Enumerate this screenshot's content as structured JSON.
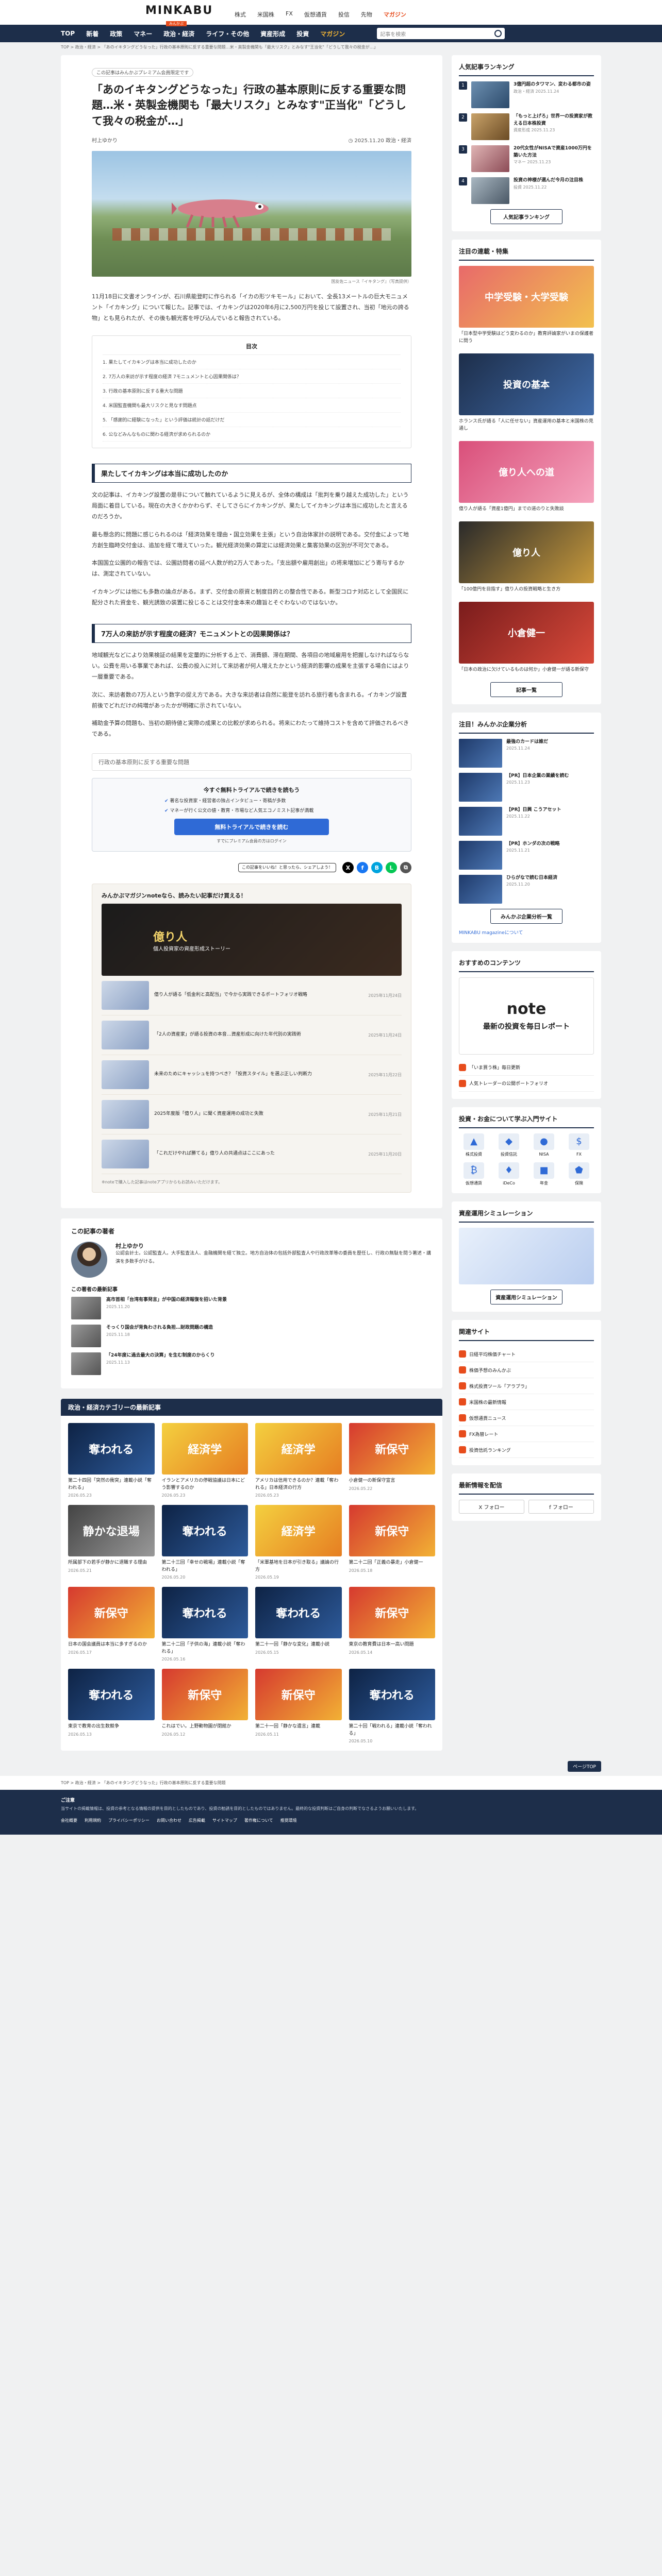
{
  "header": {
    "logo": "MINKABU",
    "logo_sub": "みんかぶ",
    "top_links": [
      "株式",
      "米国株",
      "FX",
      "仮想通貨",
      "投信",
      "先物",
      "マガジン"
    ],
    "nav": [
      "TOP",
      "新着",
      "政策",
      "マネー",
      "政治・経済",
      "ライフ・その他",
      "資産形成",
      "投資",
      "マガジン"
    ],
    "search_placeholder": "記事を検索"
  },
  "breadcrumb": "TOP > 政治・経済 > 「あのイキタングどうなった」行政の基本原則に反する重要な問題…米・英製金機関も「最大リスク」とみなす\"王当化\"「どうして我々の税金が…」",
  "article": {
    "badge": "この記事はみんかぶプレミアム会員限定です",
    "title": "「あのイキタングどうなった」行政の基本原則に反する重要な問題…米・英製金機関も「最大リスク」とみなす\"正当化\"「どうして我々の税金が…」",
    "author": "村上ゆかり",
    "date": "2025.11.20",
    "tags": "政治・経済",
    "caption": "国友佐ニュース『イキタング』（写真提供）",
    "lead": "11月18日に文書オンラインが、石川県能登町に作られる「イカの形ツキモール」において、全長13メートルの巨大モニュメント「イカキング」について報じた。記事では、イカキングは2020年6月に2,500万円を投じて設置され、当初「地元の誇る物」とも見られたが、その後も観光客を呼び込んでいると報告されている。",
    "toc_title": "目次",
    "toc": [
      "1. 果たしてイカキングは本当に成功したのか",
      "2. 7万人の来訪が示す程度の経済 7モニュメントと心因果関係は？",
      "3. 行政の基本原則に反する重大な問題",
      "4. 米国監査機関も最大リスクと見なす問題点",
      "5. 「感謝的に経験になった」という評価は統計の話だけだ",
      "6. 公などみんなものに関わる経済が求められるのか"
    ],
    "h1": "果たしてイカキングは本当に成功したのか",
    "p1": "文の記事は、イカキング設置の是非について触れているように見えるが、全体の構成は「批判を乗り越えた成功した」という局面に着目している。現在の大きくかかわらず、そしてさらにイカキングが、果たしてイカキングは本当に成功したと言えるのだろうか。",
    "p2": "最も懸念的に問題に感じられるのは「経済効果を理由・国立効果を主張」という自治体家計の説明である。交付金によって地方創生臨時交付金は、追加を経て増えていった。観光経済効果の算定には経済効果と集客効果の区別が不可欠である。",
    "p3": "本国国立公園的の報告では、公園訪問者の延べ人数が約2万人であった。「支出額や雇用創出」の将来増加にどう寄与するかは、測定されていない。",
    "p4": "イカキングには他にも多数の論点がある。まず、交付金の原資と制度目的との整合性である。新型コロナ対応として全国民に配分された資金を、観光誘致の装置に投じることは交付金本来の趣旨とそぐわないのではないか。",
    "h2": "7万人の来訪が示す程度の経済？モニュメントとの因果関係は？",
    "p5": "地域観光などにより効果検証の結果を定量的に分析する上で、消費額、滞在期間、各項目の地域雇用を把握しなければならない。公費を用いる事業であれば、公費の投入に対して来訪者が何人増えたかという経済的影響の成果を主張する場合にはより一層重要である。",
    "p6": "次に、来訪者数の7万人という数字の捉え方である。大きな来訪者は自然に能登を訪れる旅行者も含まれる。イカキング設置前後でどれだけの純増があったかが明確に示されていない。",
    "p7": "補助金予算の問題も、当初の期待値と実際の成果との比較が求められる。将来にわたって維持コストを含めて評価されるべきである。",
    "reco": "行政の基本原則に反する重要な問題",
    "cta_title": "今すぐ無料トライアルで続きを読もう",
    "cta_lines": [
      "著名な投資家・経営者の独占インタビュー・寄稿が多数",
      "マネーが行く公文の値・教育・市場など人気エコノミスト記事が満載"
    ],
    "cta_button": "無料トライアルで続きを読む",
    "cta_sub": "すでにプレミアム会員の方はログイン",
    "share_bubble": "この記事をいいね！と思ったら、シェアしよう！"
  },
  "note_box": {
    "title": "みんかぶマガジンnoteなら、読みたい記事だけ買える！",
    "banner_title": "億り人",
    "banner_sub": "個人投資家の資産形成ストーリー",
    "items": [
      {
        "text": "億り人が語る「低金利と高配当」で今から実践できるポートフォリオ戦略",
        "time": "2025年11月24日"
      },
      {
        "text": "「2人の資産家」が語る投資の本音…資産形成に向けた年代別の実践術",
        "time": "2025年11月24日"
      },
      {
        "text": "未来のためにキャッシュを持つべき？「投資スタイル」を選ぶ正しい判断力",
        "time": "2025年11月22日"
      },
      {
        "text": "2025年度版「億り人」に聞く資産運用の成功と失敗",
        "time": "2025年11月21日"
      },
      {
        "text": "「これだけやれば勝てる」億り人の共通点はここにあった",
        "time": "2025年11月20日"
      }
    ],
    "footnote": "※noteで購入した記事はnoteアプリからもお読みいただけます。"
  },
  "author_box": {
    "heading": "この記事の著者",
    "name": "村上ゆかり",
    "bio": "公認会計士。公認監査人。大手監査法人、金融機関を経て独立。地方自治体の包括外部監査人や行政改革等の委員を歴任し、行政の無駄を問う著述・講演を多数手がける。",
    "related_heading": "この著者の最新記事",
    "related": [
      {
        "title": "高市首相「台湾有事発言」が中国の経済報復を招いた背景",
        "date": "2025.11.20"
      },
      {
        "title": "そっくり国会が背負わされる負担…財政問題の構造",
        "date": "2025.11.18"
      },
      {
        "title": "「24年度に過去最大の決算」を生む制度のからくり",
        "date": "2025.11.13"
      }
    ]
  },
  "category": {
    "heading": "政治・経済カテゴリーの最新記事",
    "items": [
      {
        "img": "奪われる",
        "title": "第二十四回「突然の衝突」連載小説「奪われる」",
        "meta": "2026.05.23"
      },
      {
        "img": "経済学",
        "title": "イランとアメリカの停戦協議は日本にどう影響するのか",
        "meta": "2026.05.23"
      },
      {
        "img": "経済学",
        "title": "アメリカは信用できるのか？連載「奪われる」日本経済の行方",
        "meta": "2026.05.23"
      },
      {
        "img": "新保守",
        "title": "小倉健一の新保守宣言",
        "meta": "2026.05.22"
      },
      {
        "img": "静かな退場",
        "title": "所属部下の若手が静かに退職する理由",
        "meta": "2026.05.21"
      },
      {
        "img": "奪われる",
        "title": "第二十三回「幸せの戦場」連載小説「奪われる」",
        "meta": "2026.05.20"
      },
      {
        "img": "経済学",
        "title": "「米軍基地を日本が引き取る」議論の行方",
        "meta": "2026.05.19"
      },
      {
        "img": "新保守",
        "title": "第二十二回「正義の暴走」小倉健一",
        "meta": "2026.05.18"
      },
      {
        "img": "新保守",
        "title": "日本の国会議員は本当に多すぎるのか",
        "meta": "2026.05.17"
      },
      {
        "img": "奪われる",
        "title": "第二十二回「子供の海」連載小説「奪われる」",
        "meta": "2026.05.16"
      },
      {
        "img": "奪われる",
        "title": "第二十一回「静かな変化」連載小説",
        "meta": "2026.05.15"
      },
      {
        "img": "新保守",
        "title": "東京の教育費は日本一高い問題",
        "meta": "2026.05.14"
      },
      {
        "img": "奪われる",
        "title": "東京で教育の出生数競争",
        "meta": "2026.05.13"
      },
      {
        "img": "新保守",
        "title": "これはでい。上野動物園が閉館か",
        "meta": "2026.05.12"
      },
      {
        "img": "新保守",
        "title": "第二十一回「静かな遺言」連載",
        "meta": "2026.05.11"
      },
      {
        "img": "奪われる",
        "title": "第二十回「戦われる」連載小説「奪われる」",
        "meta": "2026.05.10"
      }
    ]
  },
  "sidebar": {
    "ranking_heading": "人気記事ランキング",
    "ranking": [
      {
        "title": "3億円超のタワマン、変わる都市の姿",
        "meta": "政治・経済 2025.11.24"
      },
      {
        "title": "「もっと上げろ」世界一の投資家が教える日本株投資",
        "meta": "資産形成 2025.11.23"
      },
      {
        "title": "20代女性がNISAで資産1000万円を築いた方法",
        "meta": "マネー 2025.11.23"
      },
      {
        "title": "投資の神様が選んだ今月の注目株",
        "meta": "投資 2025.11.22"
      }
    ],
    "ranking_button": "人気記事ランキング",
    "features_heading": "注目の連載・特集",
    "features": [
      {
        "img": "中学受験・大学受験",
        "text": "「日本型中学受験はどう変わるのか」教育評論家がいまの保護者に問う"
      },
      {
        "img": "投資の基本",
        "text": "ホランス氏が語る「人に任せない」資産運用の基本と米国株の見通し"
      },
      {
        "img": "億り人への道",
        "text": "億り人が語る「資産1億円」までの道のりと失敗談"
      },
      {
        "img": "億り人",
        "text": "「100億円を目指す」億り人の投資戦略と生き方"
      },
      {
        "img": "小倉健一",
        "text": "「日本の政治に欠けているものは何か」小倉健一が語る新保守"
      }
    ],
    "features_button": "記事一覧",
    "magazine_heading": "注目！みんかぶ企業分析",
    "magazine": [
      {
        "title": "最強のカードは誰だ",
        "meta": "2025.11.24"
      },
      {
        "title": "【PR】日本企業の業績を読む",
        "meta": "2025.11.23"
      },
      {
        "title": "【PR】日興 こうアセット",
        "meta": "2025.11.22"
      },
      {
        "title": "【PR】ホンダの次の戦略",
        "meta": "2025.11.21"
      },
      {
        "title": "ひらがなで読む日本経済",
        "meta": "2025.11.20"
      }
    ],
    "magazine_button": "みんかぶ企業分析一覧",
    "magazine_link": "MINKABU magazineについて",
    "note_heading": "おすすめのコンテンツ",
    "note_logo": "note",
    "note_sub": "最新の投資を毎日レポート",
    "content_items": [
      "「いま買う株」毎日更新",
      "人気トレーダーの公開ポートフォリオ"
    ],
    "tools_heading": "投資・お金について学ぶ入門サイト",
    "tools": [
      "株式投資",
      "投資信託",
      "NISA",
      "FX",
      "仮想通貨",
      "iDeCo",
      "年金",
      "保険"
    ],
    "sim_heading": "資産運用シミュレーション",
    "sim_button": "資産運用シミュレーション",
    "links_heading": "関連サイト",
    "links": [
      "日経平均株価チャート",
      "株価予想のみんかぶ",
      "株式投資ツール「アラプラ」",
      "米国株の最新情報",
      "仮想通貨ニュース",
      "FX為替レート",
      "投資信託ランキング"
    ],
    "follow_heading": "最新情報を配信",
    "follow": [
      "X フォロー",
      "f フォロー"
    ]
  },
  "footer": {
    "pagetop": "ページTOP",
    "crumb": "TOP > 政治・経済 > 「あのイキタングどうなった」行政の基本原則に反する重要な問題",
    "heading": "ご注意",
    "text": "当サイトの掲載情報は、投資の参考となる情報の提供を目的としたものであり、投資の勧誘を目的としたものではありません。最終的な投資判断はご自身の判断でなさるようお願いいたします。",
    "links": [
      "会社概要",
      "利用規約",
      "プライバシーポリシー",
      "お問い合わせ",
      "広告掲載",
      "サイトマップ",
      "著作権について",
      "推奨環境"
    ]
  }
}
